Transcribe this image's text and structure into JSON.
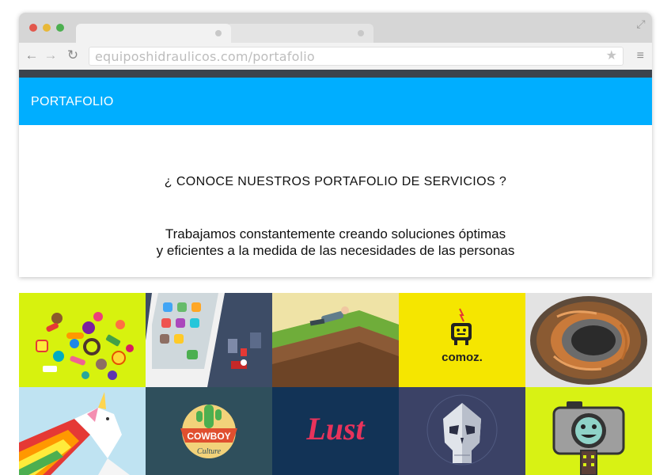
{
  "browser": {
    "url": "equiposhidraulicos.com/portafolio",
    "icons": {
      "back": "arrow-left-icon",
      "forward": "arrow-right-icon",
      "reload": "reload-icon",
      "bookmark": "star-icon",
      "menu": "hamburger-menu-icon",
      "expand": "expand-icon"
    }
  },
  "header": {
    "title": "PORTAFOLIO",
    "color": "#00aeff"
  },
  "main": {
    "question": "¿ CONOCE NUESTROS PORTAFOLIO DE SERVICIOS ?",
    "description_line1": "Trabajamos constantemente creando soluciones óptimas",
    "description_line2": "y eficientes a la medida de las necesidades de las personas"
  },
  "portfolio": {
    "tiles": [
      {
        "name": "candy-illustration",
        "bg": "#d7f20e"
      },
      {
        "name": "smartphone-illustration",
        "bg": "#3d4c66"
      },
      {
        "name": "hill-relaxing-man-illustration",
        "bg": "#9fd06b"
      },
      {
        "name": "comoz-logo",
        "bg": "#f5e600",
        "text": "comoz."
      },
      {
        "name": "copper-coil-motor-photo",
        "bg": "#e3e3e3"
      },
      {
        "name": "rainbow-unicorn-illustration",
        "bg": "#bfe3f2"
      },
      {
        "name": "cowboy-culture-logo",
        "bg": "#2f4f5c",
        "text": "COWBOY",
        "subtext": "Culture"
      },
      {
        "name": "lust-lettering",
        "bg": "#123356",
        "text": "Lust"
      },
      {
        "name": "skull-illustration",
        "bg": "#3b4266"
      },
      {
        "name": "camera-monster-illustration",
        "bg": "#d8f214"
      }
    ]
  }
}
